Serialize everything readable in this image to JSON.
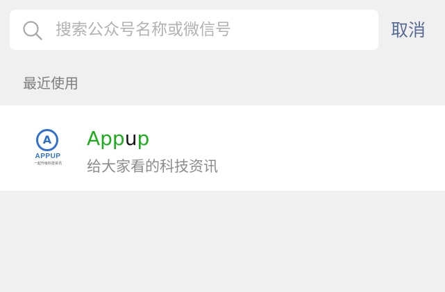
{
  "search": {
    "placeholder": "搜索公众号名称或微信号",
    "cancel_label": "取消",
    "icon": "search-icon"
  },
  "recent": {
    "section_label": "最近使用",
    "items": [
      {
        "title_parts": [
          "App",
          "u",
          "p"
        ],
        "description": "给大家看的科技资讯",
        "avatar": {
          "letter": "A",
          "brand": "APPUP",
          "tagline": "一起升级科技资讯"
        }
      }
    ]
  },
  "colors": {
    "background": "#f0f0f0",
    "accent_link": "#576b95",
    "title_green": "#1aad19",
    "logo_blue": "#2f6fcf"
  }
}
